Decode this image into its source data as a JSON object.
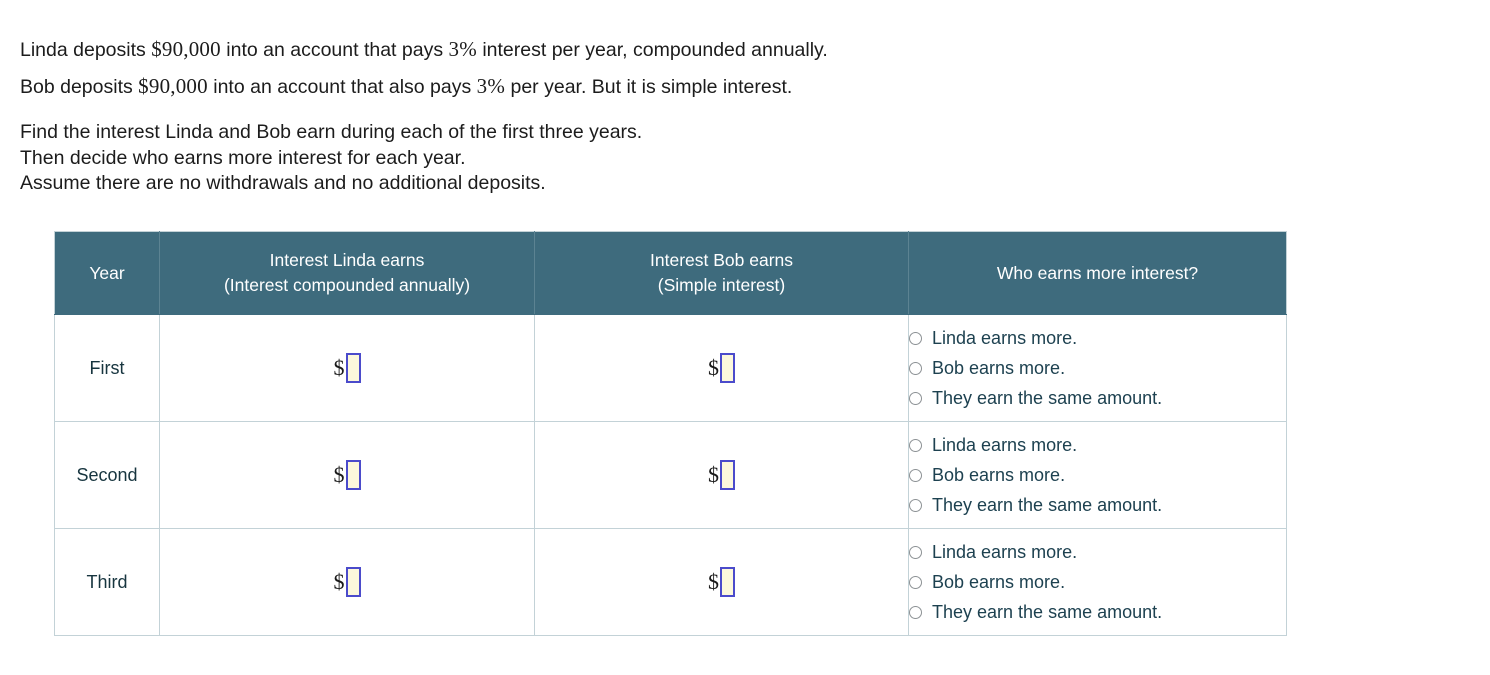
{
  "problem": {
    "lines_primary": [
      [
        {
          "t": "text",
          "v": "Linda deposits "
        },
        {
          "t": "math",
          "v": "$90,000"
        },
        {
          "t": "text",
          "v": " into an account that pays "
        },
        {
          "t": "math",
          "v": "3%"
        },
        {
          "t": "text",
          "v": " interest per year, compounded annually."
        }
      ],
      [
        {
          "t": "text",
          "v": "Bob deposits "
        },
        {
          "t": "math",
          "v": "$90,000"
        },
        {
          "t": "text",
          "v": " into an account that also pays "
        },
        {
          "t": "math",
          "v": "3%"
        },
        {
          "t": "text",
          "v": " per year. But it is simple interest."
        }
      ]
    ],
    "lines_secondary": [
      "Find the interest Linda and Bob earn during each of the first three years.",
      "Then decide who earns more interest for each year.",
      "Assume there are no withdrawals and no additional deposits."
    ]
  },
  "table": {
    "headers": [
      {
        "line1": "Year",
        "line2": ""
      },
      {
        "line1": "Interest Linda earns",
        "line2": "(Interest compounded annually)"
      },
      {
        "line1": "Interest Bob earns",
        "line2": "(Simple interest)"
      },
      {
        "line1": "Who earns more interest?",
        "line2": ""
      }
    ],
    "currency_symbol": "$",
    "rows": [
      {
        "year": "First",
        "linda_value": "",
        "bob_value": "",
        "choices": [
          {
            "label": "Linda earns more.",
            "selected": false
          },
          {
            "label": "Bob earns more.",
            "selected": false
          },
          {
            "label": "They earn the same amount.",
            "selected": false
          }
        ]
      },
      {
        "year": "Second",
        "linda_value": "",
        "bob_value": "",
        "choices": [
          {
            "label": "Linda earns more.",
            "selected": false
          },
          {
            "label": "Bob earns more.",
            "selected": false
          },
          {
            "label": "They earn the same amount.",
            "selected": false
          }
        ]
      },
      {
        "year": "Third",
        "linda_value": "",
        "bob_value": "",
        "choices": [
          {
            "label": "Linda earns more.",
            "selected": false
          },
          {
            "label": "Bob earns more.",
            "selected": false
          },
          {
            "label": "They earn the same amount.",
            "selected": false
          }
        ]
      }
    ]
  },
  "colors": {
    "header_bg": "#3e6b7d",
    "header_text": "#ffffff",
    "table_border": "#c3d2d7",
    "input_border": "#4b4bcb",
    "input_fill": "#fcf8dc",
    "choice_text": "#1d4150",
    "body_text": "#1c1c1c"
  }
}
